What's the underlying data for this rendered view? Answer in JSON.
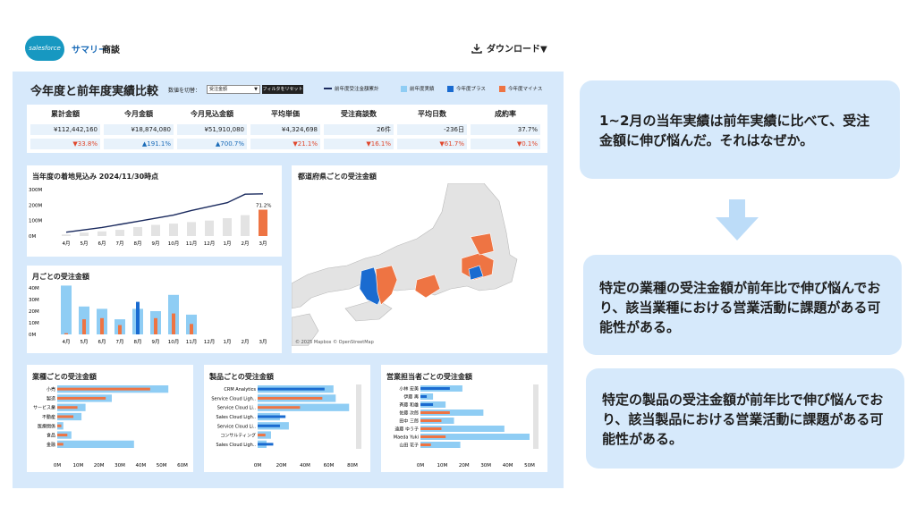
{
  "header": {
    "logo_text": "salesforce",
    "app_title": "サマリー",
    "app_subtitle": "商談",
    "download_label": "ダウンロード▼"
  },
  "dashboard": {
    "title": "今年度と前年度実績比較",
    "switch_label": "数値を切替：",
    "switch_value": "受注金額",
    "reset_label": "フィルタをリセット",
    "legend": [
      {
        "label": "前年度受注金額累計",
        "color": "#1a2a5e",
        "kind": "line"
      },
      {
        "label": "前年度実績",
        "color": "#8fcdf4",
        "kind": "square"
      },
      {
        "label": "今年度プラス",
        "color": "#1a6bd0",
        "kind": "square"
      },
      {
        "label": "今年度マイナス",
        "color": "#ee7443",
        "kind": "square"
      }
    ]
  },
  "kpis": [
    {
      "label": "累計金額",
      "value": "¥112,442,160",
      "delta": "▼33.8%",
      "trend": "down"
    },
    {
      "label": "今月金額",
      "value": "¥18,874,080",
      "delta": "▲191.1%",
      "trend": "up"
    },
    {
      "label": "今月見込金額",
      "value": "¥51,910,080",
      "delta": "▲700.7%",
      "trend": "up"
    },
    {
      "label": "平均単価",
      "value": "¥4,324,698",
      "delta": "▼21.1%",
      "trend": "down"
    },
    {
      "label": "受注商談数",
      "value": "26件",
      "delta": "▼16.1%",
      "trend": "down"
    },
    {
      "label": "平均日数",
      "value": "-236日",
      "delta": "▼61.7%",
      "trend": "down"
    },
    {
      "label": "成約率",
      "value": "37.7%",
      "delta": "▼0.1%",
      "trend": "down"
    }
  ],
  "panels": {
    "forecast_title": "当年度の着地見込み 2024/11/30時点",
    "monthly_title": "月ごとの受注金額",
    "map_title": "都道府県ごとの受注金額",
    "map_credit": "© 2025 Mapbox © OpenStreetMap",
    "industry_title": "業種ごとの受注金額",
    "product_title": "製品ごとの受注金額",
    "rep_title": "営業担当者ごとの受注金額"
  },
  "colors": {
    "prev": "#8fcdf4",
    "plus": "#1a6bd0",
    "minus": "#ee7443",
    "line": "#1a2a5e",
    "gray": "#e3e3e3"
  },
  "chart_data": [
    {
      "type": "bar",
      "title": "当年度の着地見込み 2024/11/30時点",
      "categories": [
        "4月",
        "5月",
        "6月",
        "7月",
        "8月",
        "9月",
        "10月",
        "11月",
        "12月",
        "1月",
        "2月",
        "3月"
      ],
      "ylim": [
        0,
        300
      ],
      "yticks": [
        "300M",
        "200M",
        "100M",
        "0M"
      ],
      "series": [
        {
          "name": "前年度受注金額累計",
          "kind": "line",
          "values": [
            25,
            40,
            55,
            75,
            95,
            115,
            135,
            165,
            190,
            215,
            270,
            272
          ]
        },
        {
          "name": "前年度実績",
          "values": [
            10,
            22,
            30,
            40,
            58,
            72,
            80,
            90,
            100,
            115,
            135,
            170
          ]
        }
      ],
      "annotation": "71.2%"
    },
    {
      "type": "bar",
      "title": "月ごとの受注金額",
      "categories": [
        "4月",
        "5月",
        "6月",
        "7月",
        "8月",
        "9月",
        "10月",
        "11月",
        "12月",
        "1月",
        "2月",
        "3月"
      ],
      "ylim": [
        0,
        40
      ],
      "yticks": [
        "40M",
        "30M",
        "20M",
        "10M",
        "0M"
      ],
      "series": [
        {
          "name": "前年度実績",
          "values": [
            42,
            24,
            22,
            13,
            22,
            20,
            34,
            17,
            0,
            0,
            0,
            0
          ]
        },
        {
          "name": "今年度",
          "values": [
            1,
            13,
            14,
            8,
            28,
            14,
            18,
            9,
            0,
            0,
            0,
            0
          ],
          "signs": [
            "minus",
            "minus",
            "minus",
            "minus",
            "plus",
            "minus",
            "minus",
            "minus",
            "none",
            "none",
            "none",
            "none"
          ]
        }
      ]
    },
    {
      "type": "bar",
      "orientation": "horizontal",
      "title": "業種ごとの受注金額",
      "categories": [
        "小売",
        "製造",
        "サービス業",
        "不動産",
        "医療関係",
        "食品",
        "金融"
      ],
      "xticks": [
        "0M",
        "10M",
        "20M",
        "30M",
        "40M",
        "50M",
        "60M"
      ],
      "xlim": [
        0,
        62
      ],
      "series": [
        {
          "name": "前年度実績",
          "values": [
            55,
            27,
            14,
            12,
            3,
            7,
            38
          ]
        },
        {
          "name": "今年度",
          "values": [
            46,
            24,
            10,
            8,
            2,
            5,
            3
          ],
          "signs": [
            "minus",
            "minus",
            "minus",
            "minus",
            "minus",
            "minus",
            "minus"
          ]
        }
      ]
    },
    {
      "type": "bar",
      "orientation": "horizontal",
      "title": "製品ごとの受注金額",
      "categories": [
        "CRM Analytics",
        "Service Cloud Ligh..",
        "Service Cloud Li..",
        "Sales Cloud Ligh..",
        "Service Cloud Li..",
        "コンサルティング",
        "Sales Cloud Ligh.."
      ],
      "xticks": [
        "0M",
        "20M",
        "40M",
        "60M",
        "80M"
      ],
      "xlim": [
        0,
        85
      ],
      "series": [
        {
          "name": "前年度実績",
          "values": [
            68,
            70,
            82,
            20,
            28,
            12,
            8
          ]
        },
        {
          "name": "今年度",
          "values": [
            60,
            58,
            38,
            25,
            20,
            7,
            14
          ],
          "signs": [
            "plus",
            "minus",
            "minus",
            "plus",
            "plus",
            "minus",
            "plus"
          ]
        }
      ]
    },
    {
      "type": "bar",
      "orientation": "horizontal",
      "title": "営業担当者ごとの受注金額",
      "categories": [
        "小林 宏美",
        "伊藤 再",
        "斉藤 和雄",
        "佐藤 次郎",
        "田中 三郎",
        "遠藤 ゆう子",
        "Maeda Yuki",
        "山田 花子"
      ],
      "xticks": [
        "0M",
        "10M",
        "20M",
        "30M",
        "40M",
        "50M"
      ],
      "xlim": [
        0,
        52
      ],
      "series": [
        {
          "name": "前年度実績",
          "values": [
            20,
            6,
            12,
            30,
            16,
            40,
            52,
            19
          ]
        },
        {
          "name": "今年度",
          "values": [
            14,
            3,
            6,
            14,
            10,
            10,
            12,
            5
          ],
          "signs": [
            "plus",
            "plus",
            "plus",
            "minus",
            "minus",
            "minus",
            "minus",
            "minus"
          ]
        }
      ]
    }
  ],
  "right": {
    "card1": "1~2月の当年実績は前年実績に比べて、受注金額に伸び悩んだ。それはなぜか。",
    "card2": "特定の業種の受注金額が前年比で伸び悩んでおり、該当業種における営業活動に課題がある可能性がある。",
    "card3": "特定の製品の受注金額が前年比で伸び悩んでおり、該当製品における営業活動に課題がある可能性がある。"
  }
}
